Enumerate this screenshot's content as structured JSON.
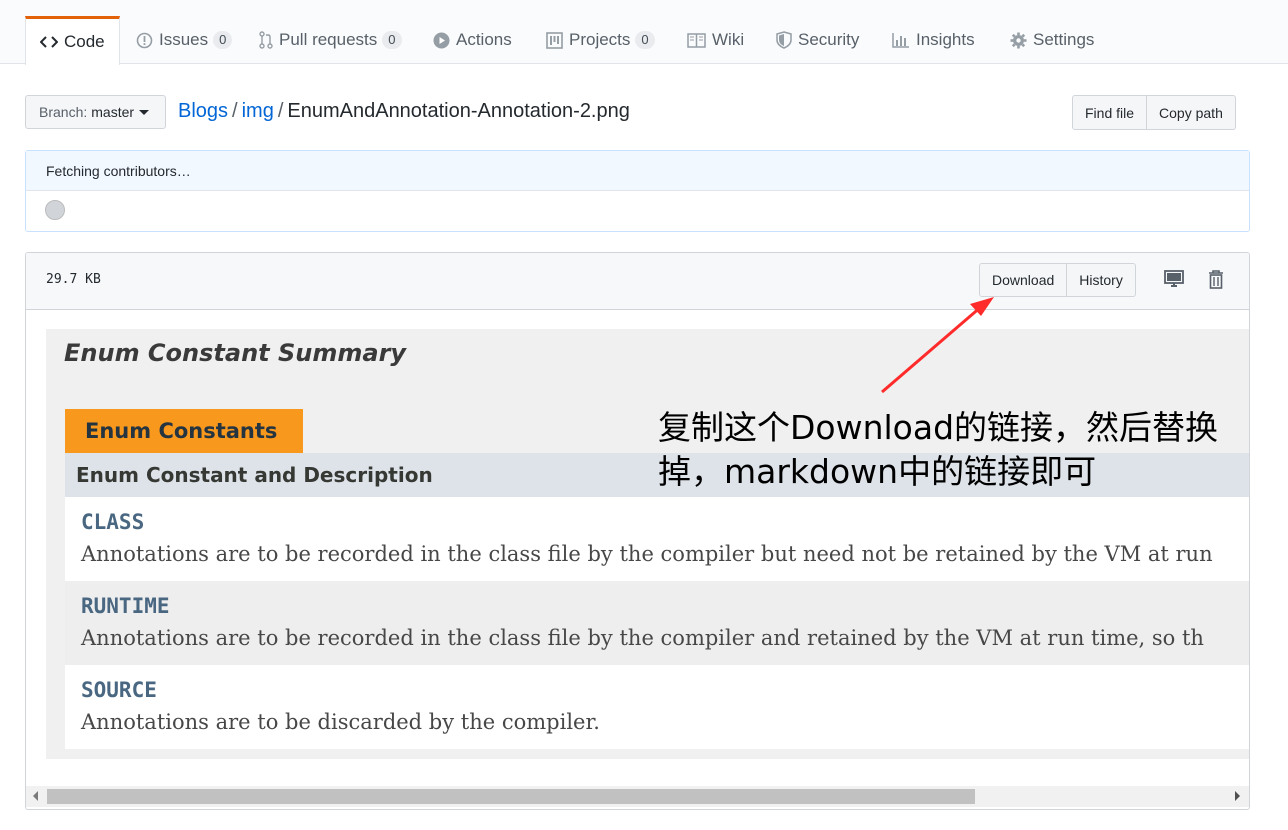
{
  "tabs": [
    {
      "label": "Code",
      "icon": "code-icon",
      "selected": true
    },
    {
      "label": "Issues",
      "icon": "issue-icon",
      "count": "0"
    },
    {
      "label": "Pull requests",
      "icon": "pull-request-icon",
      "count": "0"
    },
    {
      "label": "Actions",
      "icon": "play-icon"
    },
    {
      "label": "Projects",
      "icon": "project-icon",
      "count": "0"
    },
    {
      "label": "Wiki",
      "icon": "book-icon"
    },
    {
      "label": "Security",
      "icon": "shield-icon"
    },
    {
      "label": "Insights",
      "icon": "graph-icon"
    },
    {
      "label": "Settings",
      "icon": "gear-icon"
    }
  ],
  "branch": {
    "label": "Branch:",
    "value": "master"
  },
  "breadcrumb": {
    "repo": "Blogs",
    "folder": "img",
    "file": "EnumAndAnnotation-Annotation-2.png",
    "separator": "/"
  },
  "header_buttons": {
    "find_file": "Find file",
    "copy_path": "Copy path"
  },
  "contributors": {
    "status": "Fetching contributors…"
  },
  "file": {
    "size": "29.7 KB",
    "download": "Download",
    "history": "History"
  },
  "image": {
    "title": "Enum Constant Summary",
    "tab_label": "Enum Constants",
    "table_header": "Enum Constant and Description",
    "rows": [
      {
        "name": "CLASS",
        "desc": "Annotations are to be recorded in the class file by the compiler but need not be retained by the VM at run"
      },
      {
        "name": "RUNTIME",
        "desc": "Annotations are to be recorded in the class file by the compiler and retained by the VM at run time, so th"
      },
      {
        "name": "SOURCE",
        "desc": "Annotations are to be discarded by the compiler."
      }
    ],
    "annotation": "复制这个Download的链接，然后替换掉，markdown中的链接即可"
  },
  "colors": {
    "accent_tab": "#e36209",
    "link": "#0366d6",
    "orange_tab": "#f8981d",
    "arrow": "#ff2a2a"
  }
}
